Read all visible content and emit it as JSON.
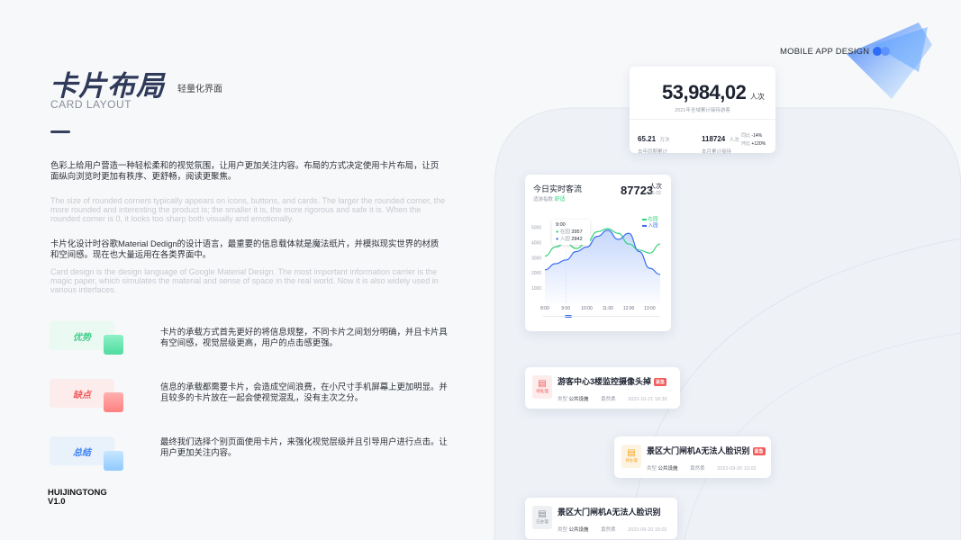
{
  "header": {
    "title_cn": "卡片布局",
    "subtitle_cn": "轻量化界面",
    "title_en": "CARD LAYOUT"
  },
  "paragraphs": {
    "p1_cn": "色彩上给用户营造一种轻松柔和的视觉氛围，让用户更加关注内容。布局的方式决定使用卡片布局，让页面纵向浏览时更加有秩序、更舒畅，阅读更聚焦。",
    "p1_en": "The size of rounded corners typically appears on icons, buttons, and cards. The larger the rounded corner, the more rounded and interesting the product is; the smaller it is, the more rigorous and safe it is. When the rounded corner is 0, it looks too sharp both visually and emotionally.",
    "p2_cn": "卡片化设计时谷歌Material Dedign的设计语言，最重要的信息载体就是魔法纸片，并模拟现实世界的材质和空间感。现在也大量运用在各类界面中。",
    "p2_en": "Card design is the design language of Google Material Design. The most important information carrier is the magic paper, which simulates the material and sense of space in the real world. Now it is also widely used in various interfaces."
  },
  "points": [
    {
      "label": "优势",
      "text": "卡片的承载方式首先更好的将信息规整，不同卡片之间划分明确，并且卡片具有空间感，视觉层级更高，用户的点击感更强。",
      "color": "#3fcf8e",
      "bg": "#eaf9f2",
      "accent": "#6ee7b7"
    },
    {
      "label": "缺点",
      "text": "信息的承载都需要卡片，会造成空间浪费，在小尺寸手机屏幕上更加明显。并且较多的卡片放在一起会使视觉混乱，没有主次之分。",
      "color": "#f25b5b",
      "bg": "#fdecec",
      "accent": "#ff9a9a"
    },
    {
      "label": "总结",
      "text": "最终我们选择个别页面使用卡片，来强化视觉层级并且引导用户进行点击。让用户更加关注内容。",
      "color": "#3b82f6",
      "bg": "#e9f1fb",
      "accent": "#9fd0ff"
    }
  ],
  "brand": {
    "line1": "HUIJINGTONG",
    "line2": "V1.0"
  },
  "mobile_label": "MOBILE APP DESIGN",
  "stats_card": {
    "value": "53,984,02",
    "unit": "人次",
    "caption": "2021年全域累计接待游客",
    "left_value": "65.21",
    "left_unit": "万次",
    "left_caption": "去年同期累计",
    "right_value": "118724",
    "right_unit": "人次",
    "right_caption": "本月累计接待",
    "yoy_label": "同比",
    "yoy_value": "-14%",
    "mom_label": "环比",
    "mom_value": "+120%"
  },
  "realtime_card": {
    "title": "今日实时客流",
    "comfort_label": "适游指数",
    "comfort_value": "舒适",
    "count": "87723",
    "unit": "人次",
    "date": "06-15",
    "legend": [
      "在园",
      "入园"
    ],
    "tooltip_time": "9:00",
    "tooltip_in_park_label": "在园",
    "tooltip_in_park_value": "3957",
    "tooltip_enter_label": "入园",
    "tooltip_enter_value": "2842",
    "colors": {
      "in_park": "#2ed47a",
      "enter": "#3b6cf2"
    }
  },
  "chart_data": {
    "type": "line",
    "x": [
      "8:00",
      "8:30",
      "9:00",
      "9:30",
      "10:00",
      "10:30",
      "11:00",
      "11:30",
      "12:00",
      "12:30",
      "13:00",
      "13:30"
    ],
    "xticks": [
      "8:00",
      "9:00",
      "10:00",
      "11:00",
      "12:00",
      "13:00"
    ],
    "yticks": [
      5000,
      4000,
      3000,
      2000,
      1000
    ],
    "ylim": [
      0,
      5500
    ],
    "series": [
      {
        "name": "在园",
        "values": [
          3100,
          3700,
          3957,
          3600,
          4000,
          4700,
          4900,
          4600,
          3900,
          3500,
          3300,
          3900
        ]
      },
      {
        "name": "入园",
        "values": [
          2200,
          2600,
          2842,
          3400,
          3700,
          4400,
          4800,
          4200,
          4600,
          3400,
          2300,
          1900
        ]
      }
    ]
  },
  "tasks": [
    {
      "title": "游客中心3楼监控摄像头掉",
      "badge": "紧急",
      "icon_label": "待处理",
      "type_label": "类型",
      "type": "公共设施",
      "person": "黄然柔",
      "date": "2022-10-21  18:30",
      "icon_color": "#f25b5b",
      "icon_bg": "#fdecec"
    },
    {
      "title": "景区大门闸机A无法人脸识别",
      "badge": "紧急",
      "icon_label": "待办理",
      "type_label": "类型",
      "type": "公共设施",
      "person": "黄然柔",
      "date": "2022-09-20  15:02",
      "icon_color": "#f5a524",
      "icon_bg": "#fdf3e2"
    },
    {
      "title": "景区大门闸机A无法人脸识别",
      "badge": "",
      "icon_label": "已办理",
      "type_label": "类型",
      "type": "公共设施",
      "person": "黄然柔",
      "date": "2022-09-20  15:02",
      "icon_color": "#8a8f99",
      "icon_bg": "#eef0f3"
    }
  ]
}
